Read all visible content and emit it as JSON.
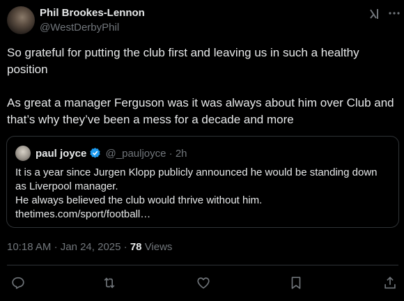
{
  "author": {
    "name": "Phil Brookes-Lennon",
    "handle": "@WestDerbyPhil"
  },
  "tweet": {
    "paragraphs": [
      "So grateful for putting the club first and leaving us in such a healthy position",
      "As great a manager Ferguson was it was always about him over Club and that’s why they’ve been a mess for a decade and more"
    ]
  },
  "quote": {
    "name": "paul joyce",
    "handle": "@_pauljoyce",
    "separator": "·",
    "time": "2h",
    "lines": [
      "It is a year since Jurgen Klopp publicly announced he would be standing down",
      "as Liverpool manager.",
      "He always believed the club would thrive without him.",
      "thetimes.com/sport/football…"
    ]
  },
  "meta": {
    "time": "10:18 AM",
    "date": "Jan 24, 2025",
    "separator": "·",
    "views_count": "78",
    "views_label": "Views"
  },
  "icons": {
    "accent": "#1d9bf0",
    "muted": "#71767b",
    "grok": "grok-icon",
    "more": "more-icon",
    "verified": "verified-badge-icon",
    "actions": [
      "reply-icon",
      "retweet-icon",
      "like-icon",
      "bookmark-icon",
      "share-icon"
    ]
  }
}
